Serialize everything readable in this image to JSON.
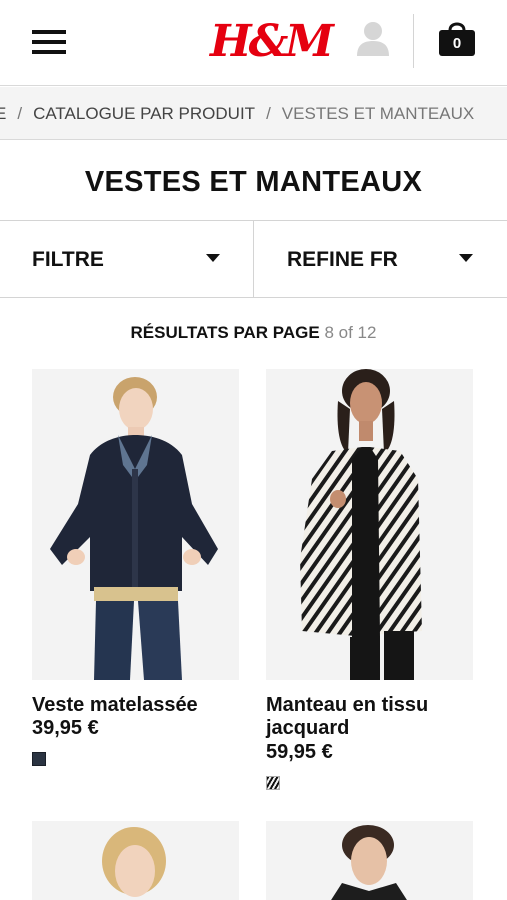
{
  "header": {
    "logo_text": "H&M",
    "cart_count": "0",
    "menu_icon": "hamburger-icon",
    "user_icon": "user-silhouette-icon",
    "cart_icon": "shopping-bag-icon",
    "brand_color": "#e50010"
  },
  "breadcrumb": {
    "items": [
      "E",
      "CATALOGUE PAR PRODUIT",
      "VESTES ET MANTEAUX"
    ],
    "separator": "/"
  },
  "page": {
    "title": "VESTES ET MANTEAUX"
  },
  "filters": {
    "filter_label": "FILTRE",
    "refine_label": "REFINE FR"
  },
  "results": {
    "label": "RÉSULTATS PAR PAGE",
    "value": "8 of 12"
  },
  "products": [
    {
      "name": "Veste matelassée",
      "price": "39,95 €",
      "swatch_color": "#2b3442"
    },
    {
      "name": "Manteau en tissu jacquard",
      "price": "59,95 €",
      "swatch_color": "zebra-pattern"
    },
    {
      "name": "",
      "price": ""
    },
    {
      "name": "",
      "price": ""
    }
  ]
}
